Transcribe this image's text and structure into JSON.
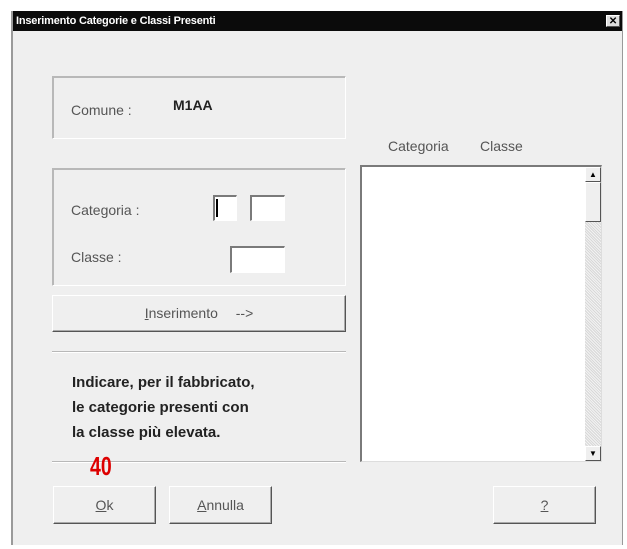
{
  "window": {
    "title": "Inserimento Categorie e Classi Presenti",
    "close_glyph": "✕"
  },
  "comune": {
    "label": "Comune :",
    "value": "M1AA"
  },
  "categoria": {
    "label": "Categoria :",
    "field1": "",
    "field2": ""
  },
  "classe": {
    "label": "Classe :",
    "field": ""
  },
  "insert_button": {
    "access_key": "I",
    "label_rest": "nserimento",
    "arrow": "-->"
  },
  "list": {
    "headers": [
      "Categoria",
      "Classe"
    ],
    "rows": []
  },
  "info_lines": [
    "Indicare, per il fabbricato,",
    "le categorie presenti con",
    "la classe più elevata."
  ],
  "annotation": "40",
  "buttons": {
    "ok": {
      "access_key": "O",
      "label_rest": "k"
    },
    "cancel": {
      "access_key": "A",
      "label_rest": "nnulla"
    },
    "help": {
      "access_key": "?",
      "label_rest": ""
    }
  }
}
